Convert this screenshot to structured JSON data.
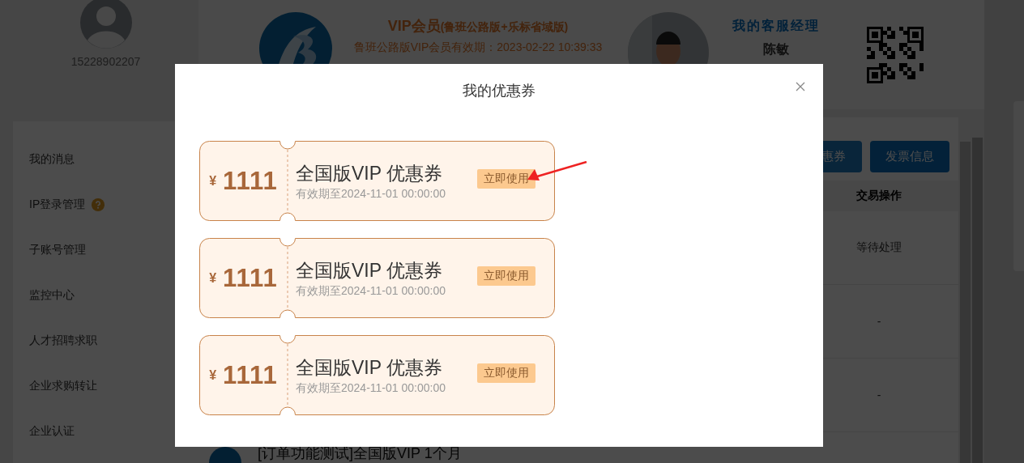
{
  "profile": {
    "phone": "15228902207"
  },
  "sidebar": {
    "items": [
      {
        "label": "我的消息",
        "help": false
      },
      {
        "label": "IP登录管理",
        "help": true
      },
      {
        "label": "子账号管理",
        "help": false
      },
      {
        "label": "监控中心",
        "help": false
      },
      {
        "label": "人才招聘求职",
        "help": false
      },
      {
        "label": "企业求购转让",
        "help": false
      },
      {
        "label": "企业认证",
        "help": false
      }
    ]
  },
  "membership": {
    "title": "VIP会员",
    "edition": "(鲁班公路版+乐标省域版)",
    "validity": "鲁班公路版VIP会员有效期：2023-02-22 10:39:33"
  },
  "manager": {
    "heading": "我的客服经理",
    "name": "陈敏"
  },
  "actions": [
    "惠券",
    "发票信息"
  ],
  "table": {
    "columns": [
      "交易操作"
    ],
    "rows": [
      [
        "等待处理"
      ],
      [
        "-"
      ],
      [
        "-"
      ]
    ]
  },
  "partial_row": "[订单功能测试]全国版VIP 1个月",
  "modal": {
    "title": "我的优惠券",
    "coupons": [
      {
        "currency": "¥",
        "amount": "1111",
        "name": "全国版VIP 优惠券",
        "validity": "有效期至2024-11-01 00:00:00",
        "action": "立即使用"
      },
      {
        "currency": "¥",
        "amount": "1111",
        "name": "全国版VIP 优惠券",
        "validity": "有效期至2024-11-01 00:00:00",
        "action": "立即使用"
      },
      {
        "currency": "¥",
        "amount": "1111",
        "name": "全国版VIP 优惠券",
        "validity": "有效期至2024-11-01 00:00:00",
        "action": "立即使用"
      }
    ]
  }
}
